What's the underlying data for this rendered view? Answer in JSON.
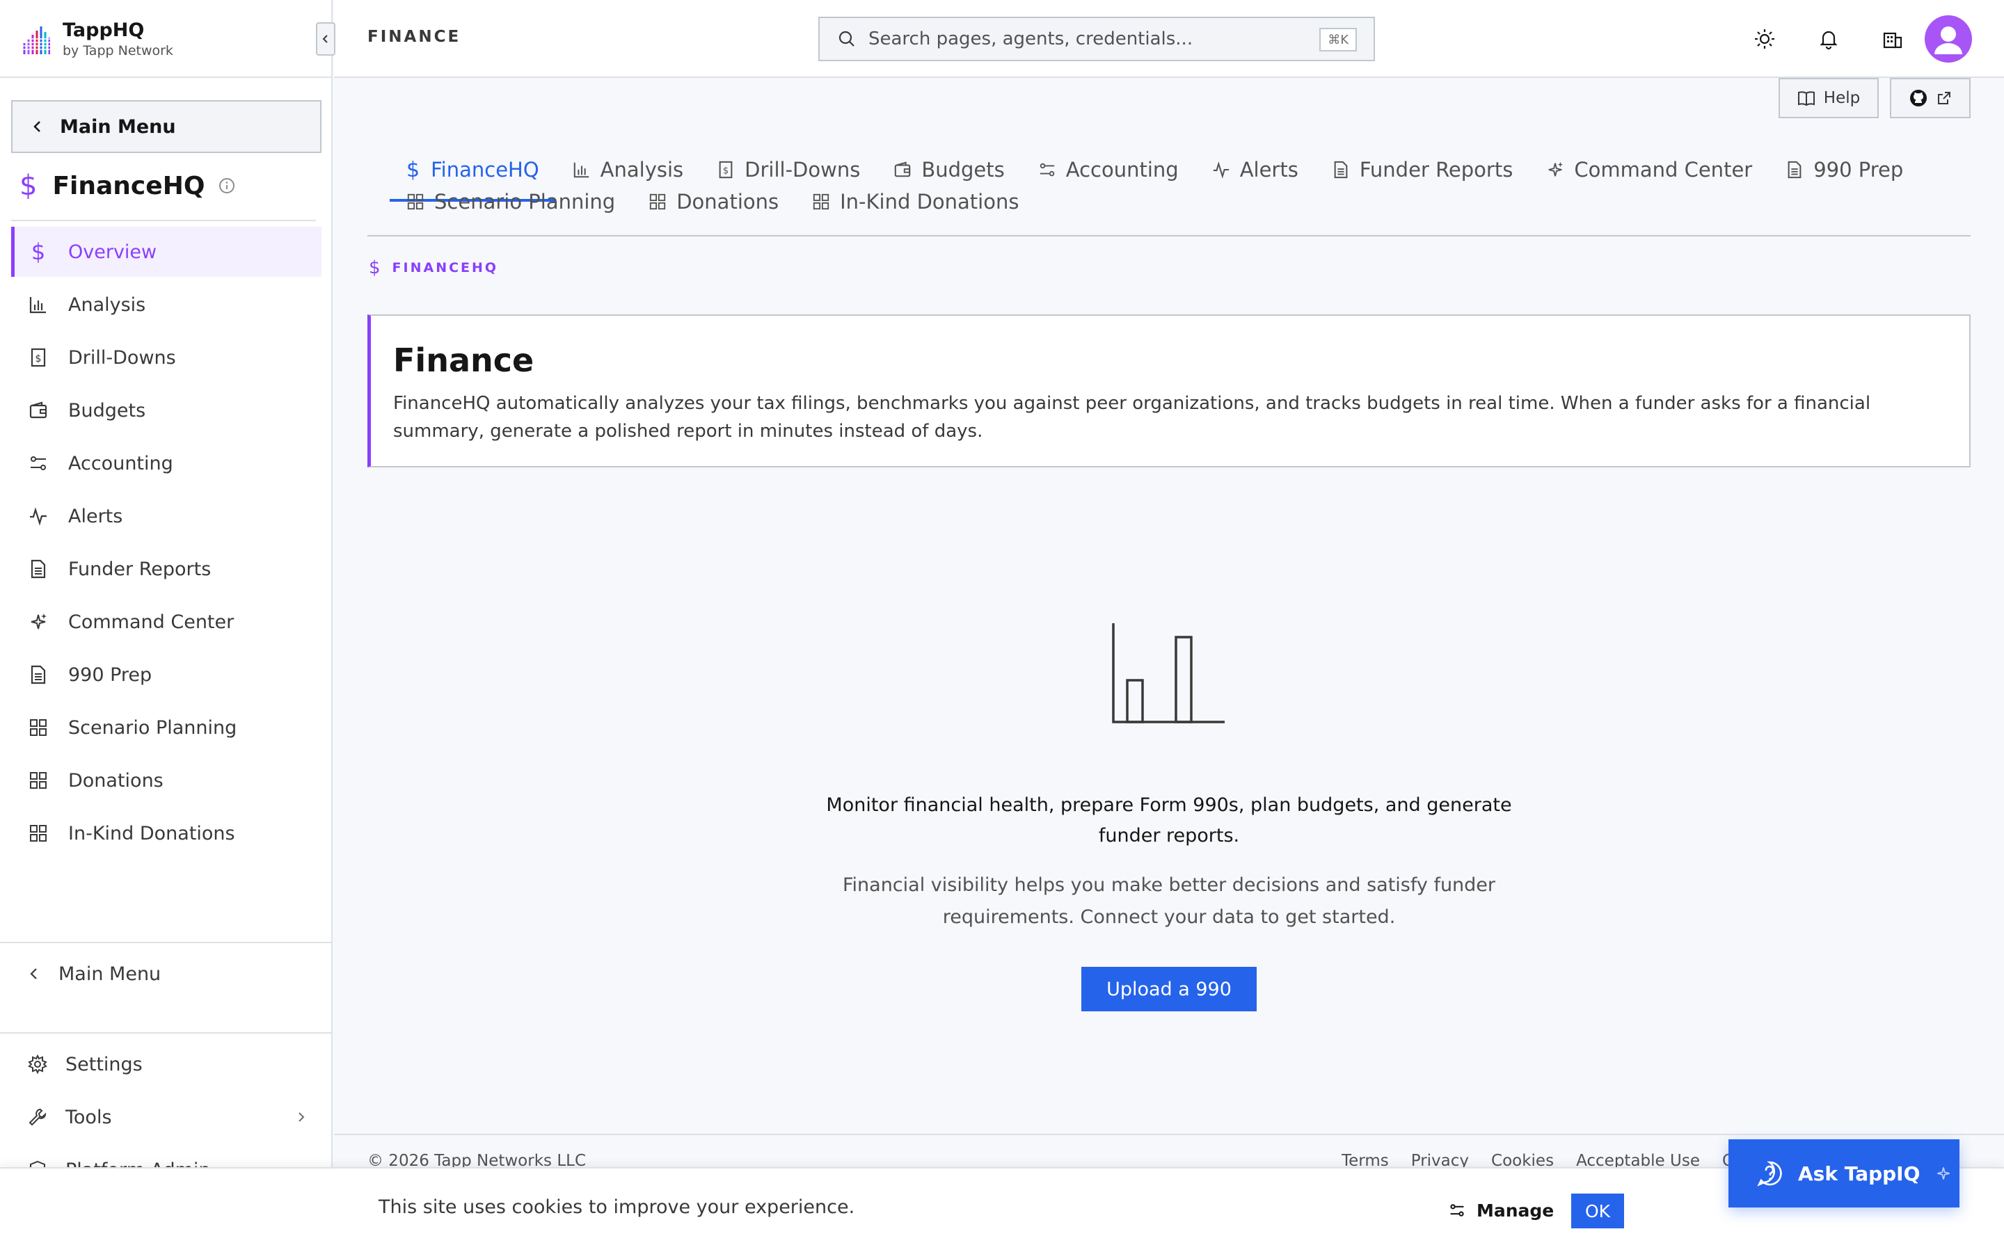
{
  "brand": {
    "name": "TappHQ",
    "sub": "by Tapp Network"
  },
  "sidebar": {
    "main_menu_label": "Main Menu",
    "section_symbol": "$",
    "section_title": "FinanceHQ",
    "items": [
      {
        "label": "Overview",
        "icon": "dollar-icon",
        "active": true
      },
      {
        "label": "Analysis",
        "icon": "bar-chart-icon"
      },
      {
        "label": "Drill-Downs",
        "icon": "receipt-icon"
      },
      {
        "label": "Budgets",
        "icon": "wallet-icon"
      },
      {
        "label": "Accounting",
        "icon": "sliders-icon"
      },
      {
        "label": "Alerts",
        "icon": "activity-icon"
      },
      {
        "label": "Funder Reports",
        "icon": "document-icon"
      },
      {
        "label": "Command Center",
        "icon": "sparkles-icon"
      },
      {
        "label": "990 Prep",
        "icon": "document-icon"
      },
      {
        "label": "Scenario Planning",
        "icon": "grid-icon"
      },
      {
        "label": "Donations",
        "icon": "grid-icon"
      },
      {
        "label": "In-Kind Donations",
        "icon": "grid-icon"
      }
    ],
    "bottom_main_menu": "Main Menu",
    "settings": "Settings",
    "tools": "Tools",
    "platform_admin": "Platform Admin"
  },
  "header": {
    "title": "FINANCE",
    "search_placeholder": "Search pages, agents, credentials...",
    "search_shortcut": "⌘K"
  },
  "help_label": "Help",
  "tabs": {
    "row1": [
      {
        "label": "FinanceHQ",
        "icon": "dollar-icon",
        "active": true
      },
      {
        "label": "Analysis",
        "icon": "bar-chart-icon"
      },
      {
        "label": "Drill-Downs",
        "icon": "receipt-icon"
      },
      {
        "label": "Budgets",
        "icon": "wallet-icon"
      },
      {
        "label": "Accounting",
        "icon": "sliders-icon"
      },
      {
        "label": "Alerts",
        "icon": "activity-icon"
      },
      {
        "label": "Funder Reports",
        "icon": "document-icon"
      },
      {
        "label": "Command Center",
        "icon": "sparkles-icon"
      },
      {
        "label": "990 Prep",
        "icon": "document-icon"
      }
    ],
    "row2": [
      {
        "label": "Scenario Planning",
        "icon": "grid-icon"
      },
      {
        "label": "Donations",
        "icon": "grid-icon"
      },
      {
        "label": "In-Kind Donations",
        "icon": "grid-icon"
      }
    ]
  },
  "content": {
    "breadcrumb": "FINANCEHQ",
    "intro_title": "Finance",
    "intro_body": "FinanceHQ automatically analyzes your tax filings, benchmarks you against peer organizations, and tracks budgets in real time. When a funder asks for a financial summary, generate a polished report in minutes instead of days.",
    "empty_lead": "Monitor financial health, prepare Form 990s, plan budgets, and generate funder reports.",
    "empty_sub": "Financial visibility helps you make better decisions and satisfy funder requirements. Connect your data to get started.",
    "upload_label": "Upload a 990"
  },
  "footer": {
    "copyright": "© 2026 Tapp Networks LLC",
    "links": [
      "Terms",
      "Privacy",
      "Cookies",
      "Acceptable Use",
      "Op"
    ]
  },
  "cookie": {
    "text": "This site uses cookies to improve your experience.",
    "manage_label": "Manage",
    "ok_label": "OK"
  },
  "ask": {
    "label": "Ask TappIQ"
  },
  "colors": {
    "accent": "#8a3ffc",
    "primary": "#2563eb",
    "avatar": "#a855f7"
  }
}
